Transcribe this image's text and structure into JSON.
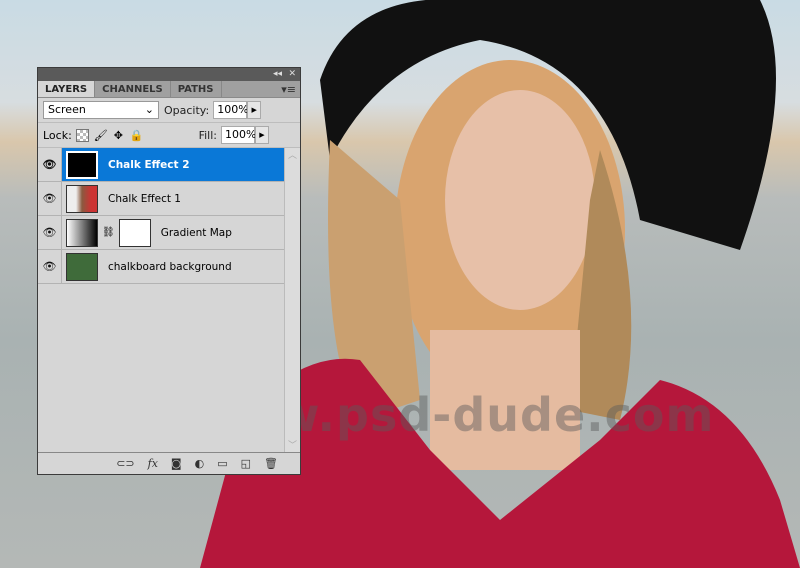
{
  "watermark": "www.psd-dude.com",
  "panel": {
    "tabs": [
      {
        "label": "LAYERS",
        "active": true
      },
      {
        "label": "CHANNELS"
      },
      {
        "label": "PATHS"
      }
    ],
    "blend_mode": "Screen",
    "opacity_label": "Opacity:",
    "opacity": "100%",
    "lock_label": "Lock:",
    "fill_label": "Fill:",
    "fill": "100%",
    "layers": [
      {
        "name": "Chalk Effect 2",
        "selected": true,
        "visible": true
      },
      {
        "name": "Chalk Effect 1",
        "visible": true
      },
      {
        "name": "Gradient Map",
        "visible": true,
        "has_mask": true
      },
      {
        "name": "chalkboard background",
        "visible": true
      }
    ],
    "colors": {
      "selection": "#0a78d7",
      "chalkboard": "#3f6b3a"
    }
  }
}
